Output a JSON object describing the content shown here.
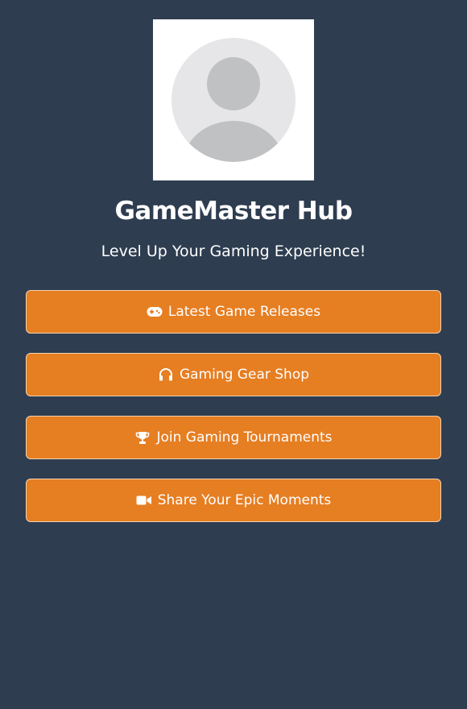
{
  "profile": {
    "title": "GameMaster Hub",
    "tagline": "Level Up Your Gaming Experience!",
    "avatar_icon": "default-avatar-icon"
  },
  "links": [
    {
      "label": "Latest Game Releases",
      "icon": "gamepad-icon"
    },
    {
      "label": "Gaming Gear Shop",
      "icon": "headphones-icon"
    },
    {
      "label": "Join Gaming Tournaments",
      "icon": "trophy-icon"
    },
    {
      "label": "Share Your Epic Moments",
      "icon": "video-camera-icon"
    }
  ],
  "colors": {
    "background": "#2e3d50",
    "button": "#e67e22",
    "button_border": "#f4d3b0",
    "text": "#ffffff"
  }
}
